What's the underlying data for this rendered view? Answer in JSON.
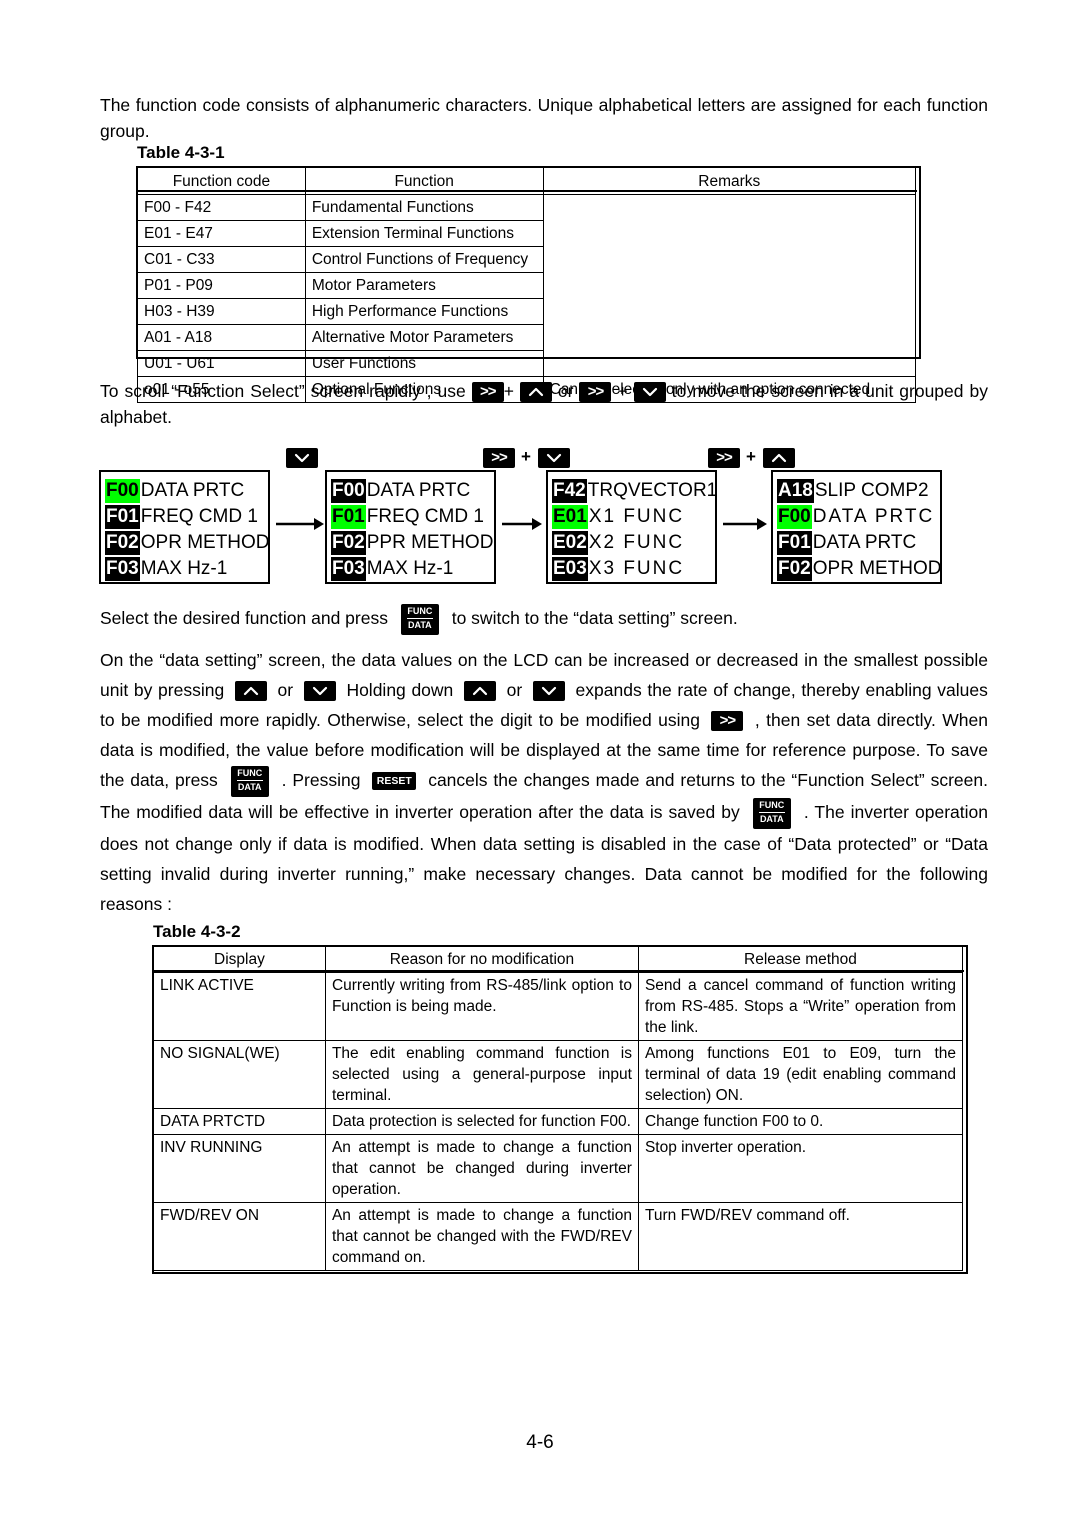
{
  "intro": {
    "paragraph": "The function code consists of alphanumeric characters.   Unique alphabetical letters are assigned for each function group."
  },
  "table_4_3_1": {
    "caption": "Table 4-3-1",
    "headers": [
      "Function code",
      "Function",
      "Remarks"
    ],
    "rows": [
      [
        "F00 - F42",
        "Fundamental Functions",
        ""
      ],
      [
        "E01 - E47",
        "Extension Terminal Functions",
        ""
      ],
      [
        "C01 - C33",
        "Control Functions of Frequency",
        ""
      ],
      [
        "P01 - P09",
        "Motor Parameters",
        ""
      ],
      [
        "H03 - H39",
        "High Performance Functions",
        ""
      ],
      [
        "A01 - A18",
        "Alternative Motor Parameters",
        ""
      ],
      [
        "U01 - U61",
        "User Functions",
        ""
      ],
      [
        "o01 - o55",
        "Optional Functions",
        "Can be selected only with an option connected"
      ]
    ]
  },
  "scroll_note": {
    "part1": "To scroll “Function Select” screen rapidly , use",
    "plus1": "+",
    "part2": "or",
    "plus2": "+",
    "part3": "to move the screen in a unit grouped by alphabet.",
    "keys": {
      "shift": ">>",
      "up": "up-arrow",
      "down": "down-arrow"
    }
  },
  "diagram": {
    "transitions": [
      {
        "keys": [
          "down-arrow"
        ],
        "plus": ""
      },
      {
        "keys": [
          ">>",
          "down-arrow"
        ],
        "plus": "+"
      },
      {
        "keys": [
          ">>",
          "up-arrow"
        ],
        "plus": "+"
      }
    ],
    "screens": [
      {
        "name": "screen-1",
        "rows": [
          {
            "code": "F00",
            "text": "DATA PRTC",
            "selected": true,
            "spaced": false
          },
          {
            "code": "F01",
            "text": "FREQ CMD 1",
            "selected": false,
            "spaced": false
          },
          {
            "code": "F02",
            "text": "OPR METHOD",
            "selected": false,
            "spaced": false
          },
          {
            "code": "F03",
            "text": "MAX Hz-1",
            "selected": false,
            "spaced": false
          }
        ]
      },
      {
        "name": "screen-2",
        "rows": [
          {
            "code": "F00",
            "text": "DATA PRTC",
            "selected": false,
            "spaced": false
          },
          {
            "code": "F01",
            "text": "FREQ CMD 1",
            "selected": true,
            "spaced": false
          },
          {
            "code": "F02",
            "text": "PPR METHOD",
            "selected": false,
            "spaced": false
          },
          {
            "code": "F03",
            "text": "MAX Hz-1",
            "selected": false,
            "spaced": false
          }
        ]
      },
      {
        "name": "screen-3",
        "rows": [
          {
            "code": "F42",
            "text": "TRQVECTOR1",
            "selected": false,
            "spaced": false
          },
          {
            "code": "E01",
            "text": "X1 FUNC",
            "selected": true,
            "spaced": true
          },
          {
            "code": "E02",
            "text": "X2 FUNC",
            "selected": false,
            "spaced": true
          },
          {
            "code": "E03",
            "text": "X3 FUNC",
            "selected": false,
            "spaced": true
          }
        ]
      },
      {
        "name": "screen-4",
        "rows": [
          {
            "code": "A18",
            "text": "SLIP COMP2",
            "selected": false,
            "spaced": false
          },
          {
            "code": "F00",
            "text": "DATA PRTC",
            "selected": true,
            "spaced": true
          },
          {
            "code": "F01",
            "text": "DATA PRTC",
            "selected": false,
            "spaced": false
          },
          {
            "code": "F02",
            "text": "OPR METHOD",
            "selected": false,
            "spaced": false
          }
        ]
      }
    ]
  },
  "body": {
    "line_select_a": "Select the desired function and press",
    "line_select_b": "to switch to the “data setting” screen.",
    "p2_a": "On the “data setting” screen, the data values on the LCD can be increased or decreased in the smallest possible unit by pressing",
    "p2_or1": "or",
    "p2_b": "Holding down",
    "p2_or2": "or",
    "p2_c": "expands the rate of change, thereby enabling values to be modified more rapidly. Otherwise, select the digit to be modified using",
    "p2_d": ", then set data directly. When data is modified, the value before modification will be displayed at the same time for reference purpose.   To save the data, press",
    "p2_e": ". Pressing",
    "p2_f": "cancels the changes made and returns to the “Function Select” screen.   The modified data will be effective in inverter operation after the data is saved by",
    "p2_g": ".   The inverter operation does not change only if data is modified. When data setting is disabled in the case of “Data protected” or “Data setting invalid during inverter running,” make necessary changes. Data cannot be modified for the following reasons :",
    "keys": {
      "funcdata_top": "FUNC",
      "funcdata_bottom": "DATA",
      "reset": "RESET",
      "shift": ">>"
    }
  },
  "table_4_3_2": {
    "caption": "Table 4-3-2",
    "headers": [
      "Display",
      "Reason for no modification",
      "Release method"
    ],
    "rows": [
      {
        "display": "LINK ACTIVE",
        "reason": "Currently writing from RS-485/link option to Function is being made.",
        "release": "Send a cancel command of function writing from RS-485.   Stops a “Write” operation from the link."
      },
      {
        "display": "NO SIGNAL(WE)",
        "reason": "The edit enabling command function is selected using a general-purpose input terminal.",
        "release": "Among functions E01 to E09, turn the terminal of data 19 (edit enabling command selection) ON."
      },
      {
        "display": "DATA PRTCTD",
        "reason": "Data protection is selected for function F00.",
        "release": "Change function F00 to 0."
      },
      {
        "display": "INV RUNNING",
        "reason": "An attempt is made to change a function that cannot be changed during inverter operation.",
        "release": "Stop inverter operation."
      },
      {
        "display": "FWD/REV ON",
        "reason": "An attempt is made to change a function that cannot be changed with the FWD/REV command on.",
        "release": "Turn FWD/REV command off."
      }
    ]
  },
  "footer": {
    "page_number": "4-6"
  },
  "colors": {
    "selection_highlight": "#00FF00",
    "key_background": "#000000",
    "text": "#000000",
    "page_background": "#FFFFFF"
  }
}
